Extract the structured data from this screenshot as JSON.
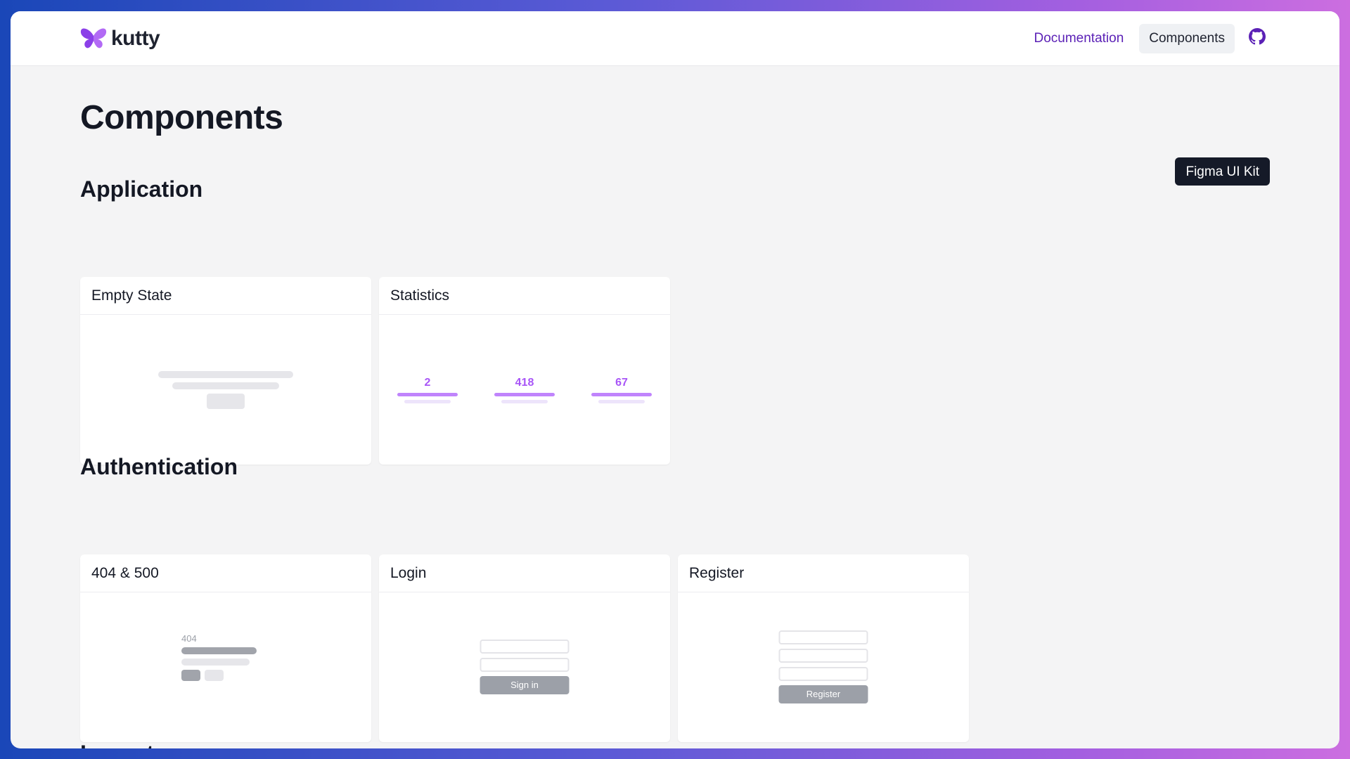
{
  "brand": {
    "name": "kutty"
  },
  "nav": {
    "documentation": "Documentation",
    "components": "Components"
  },
  "page": {
    "title": "Components",
    "figma_button": "Figma UI Kit"
  },
  "sections": {
    "application": {
      "title": "Application",
      "cards": {
        "empty_state": "Empty State",
        "statistics": "Statistics"
      },
      "stats_values": [
        "2",
        "418",
        "67"
      ]
    },
    "authentication": {
      "title": "Authentication",
      "cards": {
        "errors": "404 & 500",
        "login": "Login",
        "register": "Register"
      },
      "error_code": "404",
      "login_button": "Sign in",
      "register_button": "Register"
    },
    "layouts": {
      "title": "Layouts"
    }
  },
  "colors": {
    "accent": "#a855f7",
    "link": "#5b21b6",
    "dark_button": "#151a28"
  }
}
